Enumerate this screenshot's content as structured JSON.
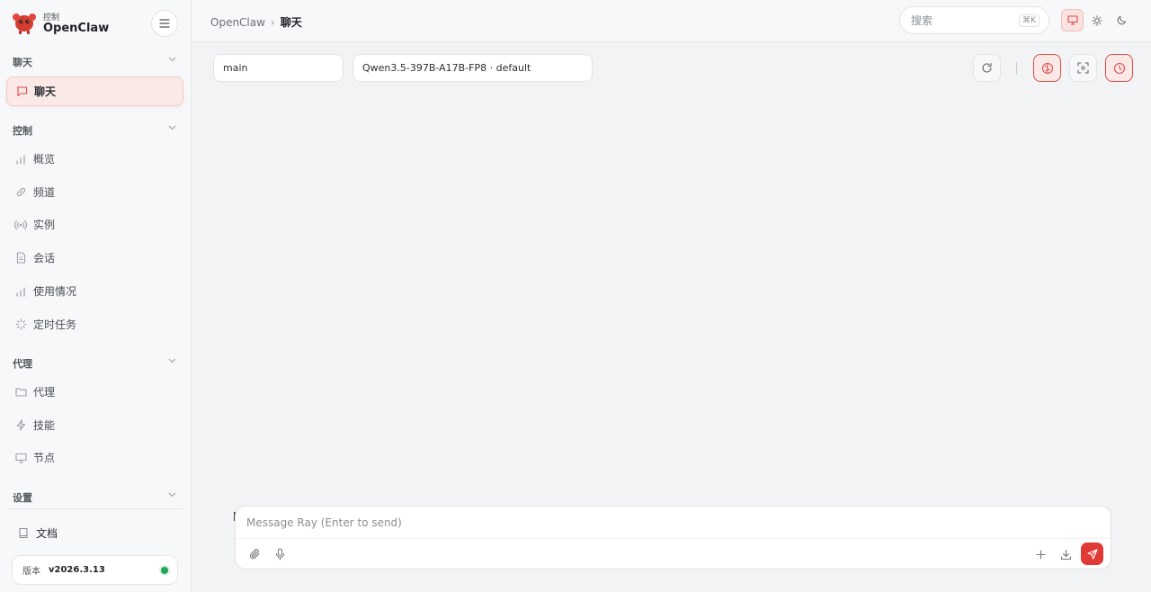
{
  "brand": {
    "subtitle": "控制",
    "name": "OpenClaw"
  },
  "sidebar": {
    "sections": [
      {
        "label": "聊天"
      },
      {
        "label": "控制"
      },
      {
        "label": "代理"
      },
      {
        "label": "设置"
      }
    ],
    "items": [
      {
        "label": "聊天",
        "icon": "message-icon"
      },
      {
        "label": "概览",
        "icon": "bar-chart-icon"
      },
      {
        "label": "频道",
        "icon": "link-icon"
      },
      {
        "label": "实例",
        "icon": "broadcast-icon"
      },
      {
        "label": "会话",
        "icon": "document-icon"
      },
      {
        "label": "使用情况",
        "icon": "bar-chart-icon"
      },
      {
        "label": "定时任务",
        "icon": "loader-icon"
      },
      {
        "label": "代理",
        "icon": "folder-icon"
      },
      {
        "label": "技能",
        "icon": "bolt-icon"
      },
      {
        "label": "节点",
        "icon": "monitor-icon"
      }
    ],
    "docs_label": "文档",
    "version_label": "版本",
    "version_value": "v2026.3.13"
  },
  "header": {
    "breadcrumb": [
      "OpenClaw",
      "聊天"
    ],
    "search_placeholder": "搜索",
    "search_shortcut": "⌘K"
  },
  "toolbar": {
    "session_value": "main",
    "model_value": "Qwen3.5-397B-A17B-FP8 · default"
  },
  "composer": {
    "placeholder": "Message Ray (Enter to send)"
  },
  "colors": {
    "accent": "#e03a36",
    "status_ok": "#22a55a"
  }
}
